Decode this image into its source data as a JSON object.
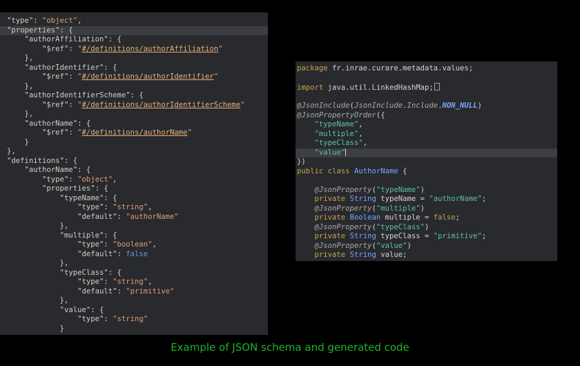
{
  "colors": {
    "background": "#000000",
    "panel": "#282a2e",
    "highlight": "#3c3e41",
    "plain": "#d4d4d4",
    "key": "#cfcfc4",
    "string": "#e59a75",
    "ref": "#e8b07a",
    "literal": "#6b96d6",
    "package": "#c8a34a",
    "keyword": "#c8a34a",
    "annotation": "#a9a9a9",
    "const": "#7aa6ff",
    "java_string": "#5ec1a0",
    "type": "#7aa6ff",
    "caption": "#22b326"
  },
  "caption": "Example of JSON schema and generated code",
  "json_lines": [
    {
      "i": 0,
      "hl": false,
      "t": [
        [
          "p",
          "\""
        ],
        [
          "k",
          "type"
        ],
        [
          "p",
          "\": "
        ],
        [
          "s",
          "\"object\""
        ],
        [
          "p",
          ","
        ]
      ]
    },
    {
      "i": 0,
      "hl": true,
      "t": [
        [
          "p",
          "\""
        ],
        [
          "k",
          "properties"
        ],
        [
          "p",
          "\": {"
        ]
      ]
    },
    {
      "i": 4,
      "hl": false,
      "t": [
        [
          "p",
          "\""
        ],
        [
          "k",
          "authorAffiliation"
        ],
        [
          "p",
          "\": {"
        ]
      ]
    },
    {
      "i": 8,
      "hl": false,
      "t": [
        [
          "p",
          "\""
        ],
        [
          "k",
          "$ref"
        ],
        [
          "p",
          "\": "
        ],
        [
          "s",
          "\""
        ],
        [
          "r",
          "#/definitions/authorAffiliation"
        ],
        [
          "s",
          "\""
        ]
      ]
    },
    {
      "i": 4,
      "hl": false,
      "t": [
        [
          "p",
          "},"
        ]
      ]
    },
    {
      "i": 4,
      "hl": false,
      "t": [
        [
          "p",
          "\""
        ],
        [
          "k",
          "authorIdentifier"
        ],
        [
          "p",
          "\": {"
        ]
      ]
    },
    {
      "i": 8,
      "hl": false,
      "t": [
        [
          "p",
          "\""
        ],
        [
          "k",
          "$ref"
        ],
        [
          "p",
          "\": "
        ],
        [
          "s",
          "\""
        ],
        [
          "r",
          "#/definitions/authorIdentifier"
        ],
        [
          "s",
          "\""
        ]
      ]
    },
    {
      "i": 4,
      "hl": false,
      "t": [
        [
          "p",
          "},"
        ]
      ]
    },
    {
      "i": 4,
      "hl": false,
      "t": [
        [
          "p",
          "\""
        ],
        [
          "k",
          "authorIdentifierScheme"
        ],
        [
          "p",
          "\": {"
        ]
      ]
    },
    {
      "i": 8,
      "hl": false,
      "t": [
        [
          "p",
          "\""
        ],
        [
          "k",
          "$ref"
        ],
        [
          "p",
          "\": "
        ],
        [
          "s",
          "\""
        ],
        [
          "r",
          "#/definitions/authorIdentifierScheme"
        ],
        [
          "s",
          "\""
        ]
      ]
    },
    {
      "i": 4,
      "hl": false,
      "t": [
        [
          "p",
          "},"
        ]
      ]
    },
    {
      "i": 4,
      "hl": false,
      "t": [
        [
          "p",
          "\""
        ],
        [
          "k",
          "authorName"
        ],
        [
          "p",
          "\": {"
        ]
      ]
    },
    {
      "i": 8,
      "hl": false,
      "t": [
        [
          "p",
          "\""
        ],
        [
          "k",
          "$ref"
        ],
        [
          "p",
          "\": "
        ],
        [
          "s",
          "\""
        ],
        [
          "r",
          "#/definitions/authorName"
        ],
        [
          "s",
          "\""
        ]
      ]
    },
    {
      "i": 4,
      "hl": false,
      "t": [
        [
          "p",
          "}"
        ]
      ]
    },
    {
      "i": 0,
      "hl": false,
      "t": [
        [
          "p",
          "},"
        ]
      ]
    },
    {
      "i": 0,
      "hl": false,
      "t": [
        [
          "p",
          "\""
        ],
        [
          "k",
          "definitions"
        ],
        [
          "p",
          "\": {"
        ]
      ]
    },
    {
      "i": 4,
      "hl": false,
      "t": [
        [
          "p",
          "\""
        ],
        [
          "k",
          "authorName"
        ],
        [
          "p",
          "\": {"
        ]
      ]
    },
    {
      "i": 8,
      "hl": false,
      "t": [
        [
          "p",
          "\""
        ],
        [
          "k",
          "type"
        ],
        [
          "p",
          "\": "
        ],
        [
          "s",
          "\"object\""
        ],
        [
          "p",
          ","
        ]
      ]
    },
    {
      "i": 8,
      "hl": false,
      "t": [
        [
          "p",
          "\""
        ],
        [
          "k",
          "properties"
        ],
        [
          "p",
          "\": {"
        ]
      ]
    },
    {
      "i": 12,
      "hl": false,
      "t": [
        [
          "p",
          "\""
        ],
        [
          "k",
          "typeName"
        ],
        [
          "p",
          "\": {"
        ]
      ]
    },
    {
      "i": 16,
      "hl": false,
      "t": [
        [
          "p",
          "\""
        ],
        [
          "k",
          "type"
        ],
        [
          "p",
          "\": "
        ],
        [
          "s",
          "\"string\""
        ],
        [
          "p",
          ","
        ]
      ]
    },
    {
      "i": 16,
      "hl": false,
      "t": [
        [
          "p",
          "\""
        ],
        [
          "k",
          "default"
        ],
        [
          "p",
          "\": "
        ],
        [
          "s",
          "\"authorName\""
        ]
      ]
    },
    {
      "i": 12,
      "hl": false,
      "t": [
        [
          "p",
          "},"
        ]
      ]
    },
    {
      "i": 12,
      "hl": false,
      "t": [
        [
          "p",
          "\""
        ],
        [
          "k",
          "multiple"
        ],
        [
          "p",
          "\": {"
        ]
      ]
    },
    {
      "i": 16,
      "hl": false,
      "t": [
        [
          "p",
          "\""
        ],
        [
          "k",
          "type"
        ],
        [
          "p",
          "\": "
        ],
        [
          "s",
          "\"boolean\""
        ],
        [
          "p",
          ","
        ]
      ]
    },
    {
      "i": 16,
      "hl": false,
      "t": [
        [
          "p",
          "\""
        ],
        [
          "k",
          "default"
        ],
        [
          "p",
          "\": "
        ],
        [
          "l",
          "false"
        ]
      ]
    },
    {
      "i": 12,
      "hl": false,
      "t": [
        [
          "p",
          "},"
        ]
      ]
    },
    {
      "i": 12,
      "hl": false,
      "t": [
        [
          "p",
          "\""
        ],
        [
          "k",
          "typeClass"
        ],
        [
          "p",
          "\": {"
        ]
      ]
    },
    {
      "i": 16,
      "hl": false,
      "t": [
        [
          "p",
          "\""
        ],
        [
          "k",
          "type"
        ],
        [
          "p",
          "\": "
        ],
        [
          "s",
          "\"string\""
        ],
        [
          "p",
          ","
        ]
      ]
    },
    {
      "i": 16,
      "hl": false,
      "t": [
        [
          "p",
          "\""
        ],
        [
          "k",
          "default"
        ],
        [
          "p",
          "\": "
        ],
        [
          "s",
          "\"primitive\""
        ]
      ]
    },
    {
      "i": 12,
      "hl": false,
      "t": [
        [
          "p",
          "},"
        ]
      ]
    },
    {
      "i": 12,
      "hl": false,
      "t": [
        [
          "p",
          "\""
        ],
        [
          "k",
          "value"
        ],
        [
          "p",
          "\": {"
        ]
      ]
    },
    {
      "i": 16,
      "hl": false,
      "t": [
        [
          "p",
          "\""
        ],
        [
          "k",
          "type"
        ],
        [
          "p",
          "\": "
        ],
        [
          "s",
          "\"string\""
        ]
      ]
    },
    {
      "i": 12,
      "hl": false,
      "t": [
        [
          "p",
          "}"
        ]
      ]
    }
  ],
  "java_lines": [
    {
      "i": 0,
      "hl": false,
      "t": [
        [
          "kw",
          "package"
        ],
        [
          "p",
          " fr.inrae.curare.metadata.values;"
        ]
      ]
    },
    {
      "i": 0,
      "hl": false,
      "t": []
    },
    {
      "i": 0,
      "hl": false,
      "t": [
        [
          "kw",
          "import"
        ],
        [
          "p",
          " java.util.LinkedHashMap;"
        ],
        [
          "box",
          ""
        ]
      ]
    },
    {
      "i": 0,
      "hl": false,
      "t": []
    },
    {
      "i": 0,
      "hl": false,
      "t": [
        [
          "an",
          "@JsonInclude"
        ],
        [
          "p",
          "("
        ],
        [
          "an",
          "JsonInclude"
        ],
        [
          "p",
          "."
        ],
        [
          "an",
          "Include"
        ],
        [
          "p",
          "."
        ],
        [
          "c",
          "NON_NULL"
        ],
        [
          "p",
          ")"
        ]
      ]
    },
    {
      "i": 0,
      "hl": false,
      "t": [
        [
          "an",
          "@JsonPropertyOrder"
        ],
        [
          "p",
          "({"
        ]
      ]
    },
    {
      "i": 4,
      "hl": false,
      "t": [
        [
          "js",
          "\"typeName\""
        ],
        [
          "p",
          ","
        ]
      ]
    },
    {
      "i": 4,
      "hl": false,
      "t": [
        [
          "js",
          "\"multiple\""
        ],
        [
          "p",
          ","
        ]
      ]
    },
    {
      "i": 4,
      "hl": false,
      "t": [
        [
          "js",
          "\"typeClass\""
        ],
        [
          "p",
          ","
        ]
      ]
    },
    {
      "i": 4,
      "hl": true,
      "t": [
        [
          "js",
          "\"value\""
        ],
        [
          "cur",
          ""
        ]
      ]
    },
    {
      "i": 0,
      "hl": false,
      "t": [
        [
          "p",
          "})"
        ]
      ]
    },
    {
      "i": 0,
      "hl": false,
      "t": [
        [
          "kw",
          "public"
        ],
        [
          "p",
          " "
        ],
        [
          "kw",
          "class"
        ],
        [
          "p",
          " "
        ],
        [
          "ty",
          "AuthorName"
        ],
        [
          "p",
          " {"
        ]
      ]
    },
    {
      "i": 0,
      "hl": false,
      "t": []
    },
    {
      "i": 4,
      "hl": false,
      "t": [
        [
          "an",
          "@JsonProperty"
        ],
        [
          "p",
          "("
        ],
        [
          "js",
          "\"typeName\""
        ],
        [
          "p",
          ")"
        ]
      ]
    },
    {
      "i": 4,
      "hl": false,
      "t": [
        [
          "kw",
          "private"
        ],
        [
          "p",
          " "
        ],
        [
          "ty",
          "String"
        ],
        [
          "p",
          " typeName = "
        ],
        [
          "js",
          "\"authorName\""
        ],
        [
          "p",
          ";"
        ]
      ]
    },
    {
      "i": 4,
      "hl": false,
      "t": [
        [
          "an",
          "@JsonProperty"
        ],
        [
          "p",
          "("
        ],
        [
          "js",
          "\"multiple\""
        ],
        [
          "p",
          ")"
        ]
      ]
    },
    {
      "i": 4,
      "hl": false,
      "t": [
        [
          "kw",
          "private"
        ],
        [
          "p",
          " "
        ],
        [
          "ty",
          "Boolean"
        ],
        [
          "p",
          " multiple = "
        ],
        [
          "kw",
          "false"
        ],
        [
          "p",
          ";"
        ]
      ]
    },
    {
      "i": 4,
      "hl": false,
      "t": [
        [
          "an",
          "@JsonProperty"
        ],
        [
          "p",
          "("
        ],
        [
          "js",
          "\"typeClass\""
        ],
        [
          "p",
          ")"
        ]
      ]
    },
    {
      "i": 4,
      "hl": false,
      "t": [
        [
          "kw",
          "private"
        ],
        [
          "p",
          " "
        ],
        [
          "ty",
          "String"
        ],
        [
          "p",
          " typeClass = "
        ],
        [
          "js",
          "\"primitive\""
        ],
        [
          "p",
          ";"
        ]
      ]
    },
    {
      "i": 4,
      "hl": false,
      "t": [
        [
          "an",
          "@JsonProperty"
        ],
        [
          "p",
          "("
        ],
        [
          "js",
          "\"value\""
        ],
        [
          "p",
          ")"
        ]
      ]
    },
    {
      "i": 4,
      "hl": false,
      "t": [
        [
          "kw",
          "private"
        ],
        [
          "p",
          " "
        ],
        [
          "ty",
          "String"
        ],
        [
          "p",
          " value;"
        ]
      ]
    }
  ]
}
